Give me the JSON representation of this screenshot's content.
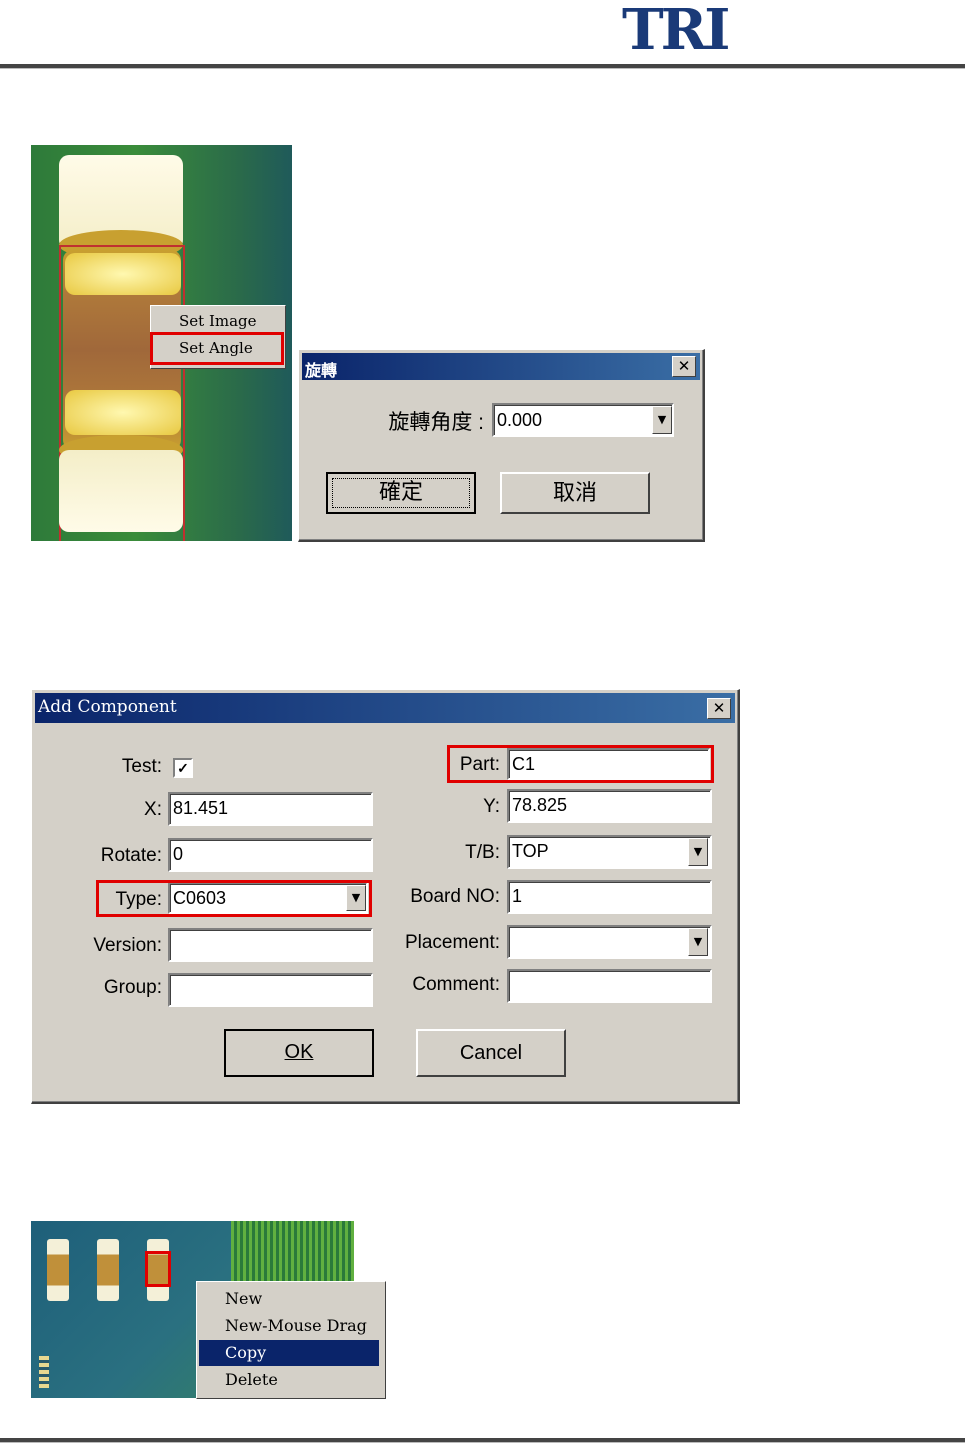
{
  "header": {
    "logo": "TRI"
  },
  "context_menu_1": {
    "items": [
      "Set Image",
      "Set Angle"
    ]
  },
  "rotate_dialog": {
    "title": "旋轉",
    "angle_label": "旋轉角度 :",
    "angle_value": "0.000",
    "ok_label": "確定",
    "cancel_label": "取消"
  },
  "add_component": {
    "title": "Add Component",
    "test_label": "Test:",
    "test_checked": "✓",
    "x_label": "X:",
    "x_value": "81.451",
    "rotate_label": "Rotate:",
    "rotate_value": "0",
    "type_label": "Type:",
    "type_value": "C0603",
    "version_label": "Version:",
    "version_value": "",
    "group_label": "Group:",
    "group_value": "",
    "part_label": "Part:",
    "part_value": "C1",
    "y_label": "Y:",
    "y_value": "78.825",
    "tb_label": "T/B:",
    "tb_value": "TOP",
    "board_label": "Board NO:",
    "board_value": "1",
    "placement_label": "Placement:",
    "placement_value": "",
    "comment_label": "Comment:",
    "comment_value": "",
    "ok_label": "OK",
    "cancel_label": "Cancel"
  },
  "context_menu_2": {
    "items": [
      "New",
      "New-Mouse Drag",
      "Copy",
      "Delete"
    ],
    "highlight_color": "#0a246a"
  }
}
